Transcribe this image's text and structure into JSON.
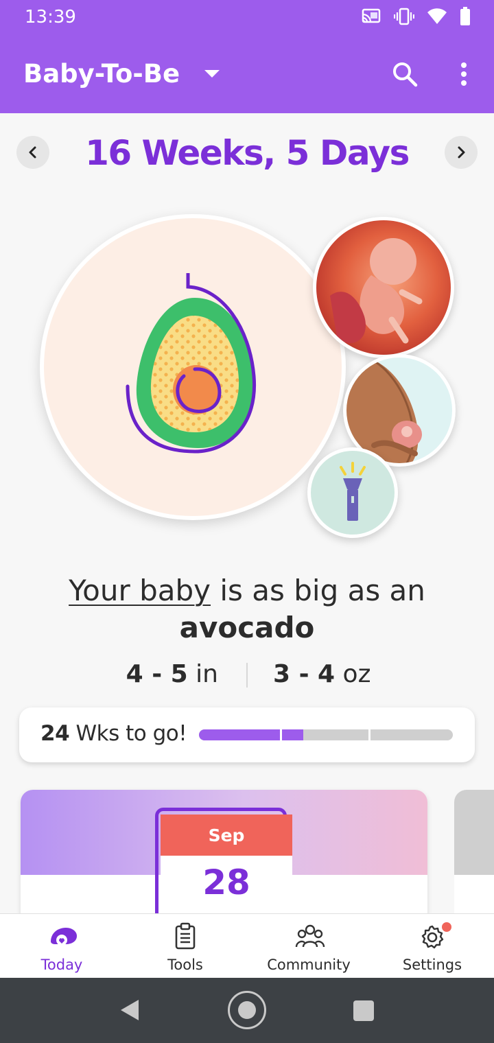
{
  "status_bar": {
    "time": "13:39",
    "icons": [
      "cast-icon",
      "vibrate-icon",
      "wifi-icon",
      "battery-icon"
    ]
  },
  "app_bar": {
    "title": "Baby-To-Be",
    "icons": [
      "dropdown-caret-icon",
      "search-icon",
      "more-vert-icon"
    ]
  },
  "week": {
    "title": "16 Weeks, 5 Days"
  },
  "illustrations": [
    "avocado",
    "fetus",
    "belly",
    "flashlight"
  ],
  "size": {
    "link_text": "Your baby",
    "text_middle": " is as big as an",
    "fruit": "avocado",
    "length_value": "4 - 5",
    "length_unit": " in",
    "weight_value": "3 - 4",
    "weight_unit": " oz"
  },
  "progress": {
    "weeks_left": "24",
    "suffix": " Wks to go!",
    "fraction": 0.41
  },
  "date_card": {
    "month": "Sep",
    "day": "28"
  },
  "bottom_nav": {
    "items": [
      {
        "label": "Today",
        "icon": "baby-today-icon",
        "active": true
      },
      {
        "label": "Tools",
        "icon": "clipboard-icon",
        "active": false
      },
      {
        "label": "Community",
        "icon": "people-icon",
        "active": false
      },
      {
        "label": "Settings",
        "icon": "gear-icon",
        "active": false
      }
    ]
  },
  "colors": {
    "primary": "#9d5cec",
    "accent": "#7b2fd8",
    "coral": "#f0645a",
    "avocado_green": "#3dbf6b"
  }
}
